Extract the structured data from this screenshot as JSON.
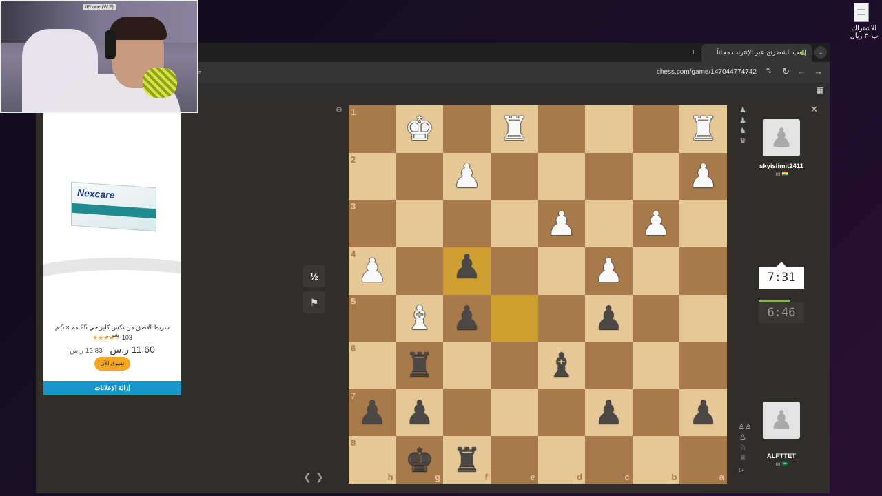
{
  "desktop": {
    "icon_label": "الاشتراك ب٣٠ ريال"
  },
  "browser": {
    "tab_title": "إلعب الشطرنج عبر الإنترنت مجاناً",
    "url": "chess.com/game/147044774742"
  },
  "webcam": {
    "label": "iPhone (W.F)"
  },
  "ad": {
    "brand": "Nexcare",
    "title": "شريط الاصق من تكس كاير جي 25 مم × 5 م شر...",
    "rating_count": "103",
    "stars": "★★★★☆",
    "price_now": "11.60 ر.س",
    "price_was": "12.83 ر.س",
    "shop_button": "تسوق الآن",
    "remove_ads": "إزالة الإعلانات"
  },
  "board": {
    "orientation": "black",
    "ranks": [
      "1",
      "2",
      "3",
      "4",
      "5",
      "6",
      "7",
      "8"
    ],
    "files": [
      "h",
      "g",
      "f",
      "e",
      "d",
      "c",
      "b",
      "a"
    ],
    "highlight_squares": [
      "f4",
      "e5"
    ],
    "pieces": {
      "g1": "wK",
      "e1": "wR",
      "a1": "wR",
      "f2": "wP",
      "a2": "wP",
      "d3": "wP",
      "b3": "wP",
      "h4": "wP",
      "c4": "wP",
      "f4": "bP",
      "g5": "wB",
      "f5": "bP",
      "c5": "bP",
      "g6": "bR",
      "d6": "bB",
      "h7": "bP",
      "g7": "bP",
      "c7": "bP",
      "a7": "bP",
      "g8": "bK",
      "f8": "bR"
    }
  },
  "controls": {
    "draw": "½",
    "resign_icon": "flag-icon"
  },
  "opponent": {
    "name": "skyislimit2411",
    "flag": "ıııı 🇮🇳",
    "clock": "7:31",
    "captured": [
      "♟",
      "♟",
      "♞",
      "♛"
    ]
  },
  "player": {
    "name": "ALFTTET",
    "flag": "ıııı 🇸🇦",
    "clock": "6:46",
    "captured": [
      "♙♙",
      "♙",
      "♘",
      "♕"
    ],
    "material": "1+"
  }
}
